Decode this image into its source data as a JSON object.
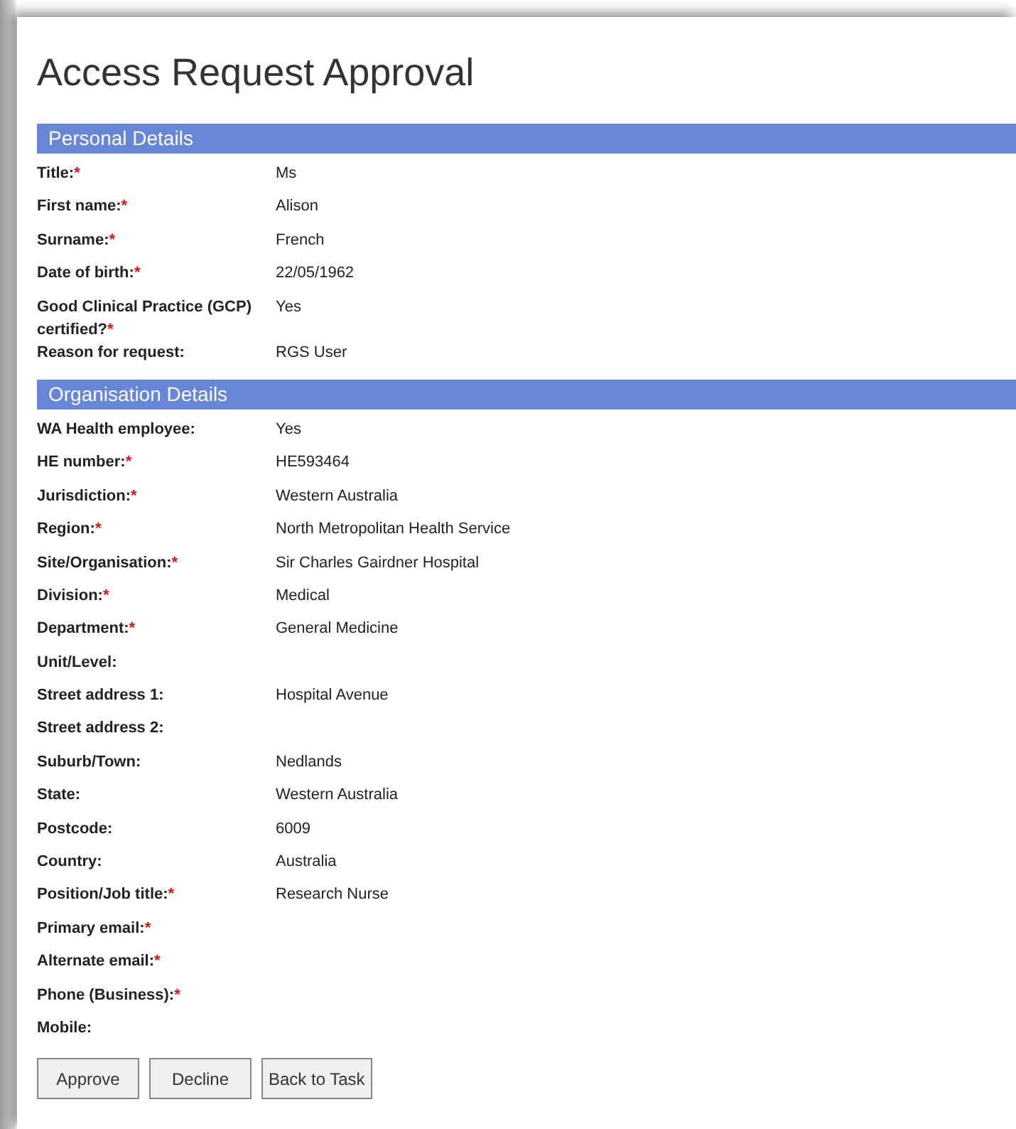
{
  "title": "Access Request Approval",
  "sections": [
    {
      "title": "Personal Details",
      "fields": [
        {
          "label": "Title:",
          "required_mark": "*",
          "value": "Ms"
        },
        {
          "label": "First name:",
          "required_mark": "*",
          "value": "Alison"
        },
        {
          "label": "Surname:",
          "required_mark": "*",
          "value": "French"
        },
        {
          "label": "Date of birth:",
          "required_mark": "*",
          "value": "22/05/1962"
        },
        {
          "label": "Good Clinical Practice (GCP) certified?",
          "required_mark": "*",
          "value": "Yes"
        },
        {
          "label": "Reason for request:",
          "value": "RGS User"
        }
      ]
    },
    {
      "title": "Organisation Details",
      "fields": [
        {
          "label": "WA Health employee:",
          "value": "Yes"
        },
        {
          "label": "HE number:",
          "required_mark": "*",
          "value": "HE593464"
        },
        {
          "label": "Jurisdiction:",
          "required_mark": "*",
          "value": "Western Australia"
        },
        {
          "label": "Region:",
          "required_mark": "*",
          "value": "North Metropolitan Health Service"
        },
        {
          "label": "Site/Organisation:",
          "required_mark": "*",
          "value": "Sir Charles Gairdner Hospital"
        },
        {
          "label": "Division:",
          "required_mark": "*",
          "value": "Medical"
        },
        {
          "label": "Department:",
          "required_mark": "*",
          "value": "General Medicine"
        },
        {
          "label": "Unit/Level:"
        },
        {
          "label": "Street address 1:",
          "value": "Hospital Avenue"
        },
        {
          "label": "Street address 2:"
        },
        {
          "label": "Suburb/Town:",
          "value": "Nedlands"
        },
        {
          "label": "State:",
          "value": "Western Australia"
        },
        {
          "label": "Postcode:",
          "value": "6009"
        },
        {
          "label": "Country:",
          "value": "Australia"
        },
        {
          "label": "Position/Job title:",
          "required_mark": "*",
          "value": "Research Nurse"
        },
        {
          "label": "Primary email:",
          "required_mark": "*"
        },
        {
          "label": "Alternate email:",
          "required_mark": "*"
        },
        {
          "label": "Phone (Business):",
          "required_mark": "*"
        },
        {
          "label": "Mobile:"
        }
      ]
    }
  ],
  "buttons": [
    "Approve",
    "Decline",
    "Back to Task"
  ]
}
